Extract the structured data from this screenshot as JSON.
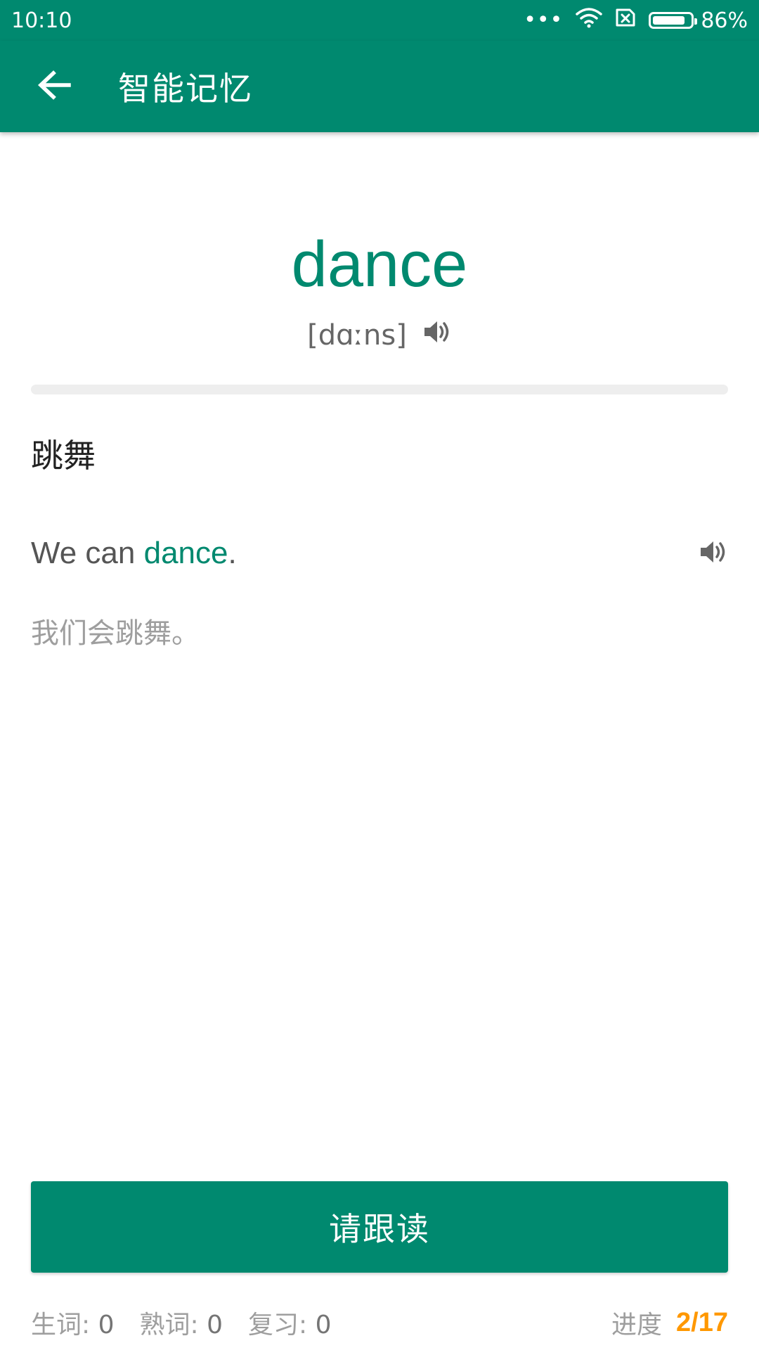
{
  "status_bar": {
    "time": "10:10",
    "dots": "•••",
    "battery_percent_label": "86%",
    "battery_level": 0.86,
    "icons": [
      "more-dots-icon",
      "wifi-icon",
      "sim-x-icon",
      "battery-icon"
    ]
  },
  "app_bar": {
    "title": "智能记忆",
    "back_icon": "arrow-left-icon"
  },
  "word": {
    "text": "dance",
    "phonetic": "[dɑːns]",
    "speaker_icon": "speaker-icon"
  },
  "learning_progress": 0.0,
  "meaning": "跳舞",
  "example": {
    "prefix": "We can ",
    "highlight": "dance",
    "suffix": ".",
    "translation": "我们会跳舞。",
    "speaker_icon": "speaker-icon"
  },
  "action_button": {
    "label": "请跟读"
  },
  "footer": {
    "new_words_label": "生词",
    "new_words_value": "0",
    "known_words_label": "熟词",
    "known_words_value": "0",
    "review_label": "复习",
    "review_value": "0",
    "progress_label": "进度",
    "progress_value": "2/17"
  },
  "colors": {
    "primary": "#00896f",
    "accent": "#ff9800"
  }
}
